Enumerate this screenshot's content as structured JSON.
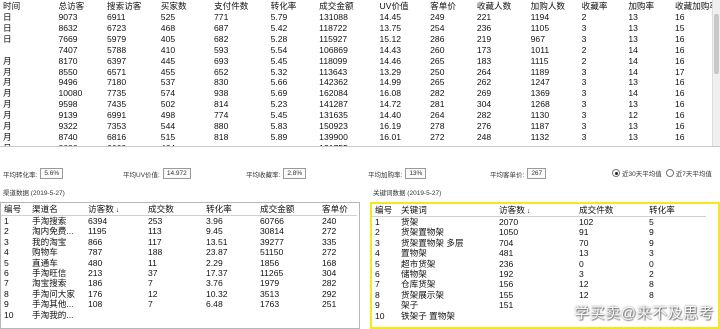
{
  "top_table": {
    "headers": [
      "时间",
      "总访客",
      "搜索访客",
      "买家数",
      "支付件数",
      "转化率",
      "成交金额",
      "UV价值",
      "客单价",
      "收藏人数",
      "加购人数",
      "收藏率",
      "加购率",
      "收藏加购率"
    ],
    "rows": [
      [
        "日",
        "9073",
        "6911",
        "525",
        "771",
        "5.79",
        "131088",
        "14.45",
        "249",
        "221",
        "1194",
        "2",
        "13",
        "16"
      ],
      [
        "日",
        "8632",
        "6723",
        "468",
        "687",
        "5.42",
        "118722",
        "13.75",
        "254",
        "236",
        "1105",
        "3",
        "13",
        "15"
      ],
      [
        "日",
        "7669",
        "5979",
        "405",
        "682",
        "5.28",
        "115927",
        "15.12",
        "286",
        "219",
        "967",
        "3",
        "13",
        "16"
      ],
      [
        "",
        "7407",
        "5788",
        "410",
        "593",
        "5.54",
        "106869",
        "14.43",
        "260",
        "173",
        "1011",
        "2",
        "14",
        "16"
      ],
      [
        "月",
        "8170",
        "6397",
        "445",
        "693",
        "5.45",
        "118099",
        "14.46",
        "265",
        "183",
        "1115",
        "2",
        "14",
        "16"
      ],
      [
        "月",
        "8550",
        "6571",
        "455",
        "652",
        "5.32",
        "113643",
        "13.29",
        "250",
        "264",
        "1189",
        "3",
        "14",
        "17"
      ],
      [
        "月",
        "9496",
        "7180",
        "537",
        "830",
        "5.66",
        "142362",
        "14.99",
        "265",
        "262",
        "1247",
        "3",
        "13",
        "16"
      ],
      [
        "月",
        "10080",
        "7735",
        "574",
        "938",
        "5.69",
        "162084",
        "16.08",
        "282",
        "269",
        "1369",
        "3",
        "14",
        "16"
      ],
      [
        "月",
        "9598",
        "7435",
        "502",
        "814",
        "5.23",
        "141287",
        "14.72",
        "281",
        "304",
        "1268",
        "3",
        "13",
        "16"
      ],
      [
        "月",
        "9139",
        "6991",
        "498",
        "774",
        "5.45",
        "131635",
        "14.40",
        "264",
        "282",
        "1130",
        "3",
        "12",
        "16"
      ],
      [
        "月",
        "9322",
        "7353",
        "544",
        "880",
        "5.83",
        "150923",
        "16.19",
        "278",
        "276",
        "1187",
        "3",
        "13",
        "16"
      ],
      [
        "月",
        "8740",
        "6816",
        "515",
        "818",
        "5.89",
        "139900",
        "16.01",
        "272",
        "248",
        "1132",
        "3",
        "13",
        "16"
      ],
      [
        "月",
        "8686",
        "6660",
        "464",
        "",
        "",
        "131755",
        "",
        "",
        "",
        "",
        "",
        "",
        ""
      ]
    ]
  },
  "summary": {
    "items": [
      {
        "label": "平均转化率:",
        "value": "5.6%"
      },
      {
        "label": "平均UV价值:",
        "value": "14.972"
      },
      {
        "label": "平均收藏率:",
        "value": "2.8%"
      },
      {
        "label": "平均加购率:",
        "value": "13%"
      },
      {
        "label": "平均客单价:",
        "value": "267"
      }
    ],
    "radio_30": "近30天平均值",
    "radio_7": "近7天平均值"
  },
  "channel_panel": {
    "title": "渠道数据 (2019-5-27)",
    "headers": [
      "编号",
      "渠道名",
      "访客数",
      "成交数",
      "转化率",
      "成交金额",
      "客单价"
    ],
    "sort_indicator": "↓",
    "rows": [
      [
        "1",
        "手淘搜索",
        "6394",
        "253",
        "3.96",
        "60766",
        "240"
      ],
      [
        "2",
        "淘内免费...",
        "1195",
        "113",
        "9.45",
        "30814",
        "272"
      ],
      [
        "3",
        "我的淘宝",
        "866",
        "117",
        "13.51",
        "39277",
        "335"
      ],
      [
        "4",
        "购物车",
        "787",
        "188",
        "23.87",
        "51150",
        "272"
      ],
      [
        "5",
        "直通车",
        "480",
        "11",
        "2.29",
        "1856",
        "168"
      ],
      [
        "6",
        "手淘旺信",
        "213",
        "37",
        "17.37",
        "11265",
        "304"
      ],
      [
        "7",
        "淘宝搜索",
        "186",
        "7",
        "3.76",
        "1979",
        "282"
      ],
      [
        "8",
        "手淘问大家",
        "176",
        "12",
        "10.32",
        "3513",
        "292"
      ],
      [
        "9",
        "手淘其他...",
        "108",
        "7",
        "6.48",
        "1763",
        "251"
      ],
      [
        "10",
        "手淘我的...",
        "",
        "",
        "",
        "",
        ""
      ]
    ]
  },
  "keyword_panel": {
    "title": "关键词数据 (2019-5-27)",
    "headers": [
      "编号",
      "关键词",
      "访客数",
      "成交件数",
      "转化率"
    ],
    "sort_indicator": "↓",
    "rows": [
      [
        "1",
        "货架",
        "2070",
        "102",
        "5"
      ],
      [
        "2",
        "货架置物架",
        "1050",
        "91",
        "9"
      ],
      [
        "3",
        "货架置物架 多层",
        "704",
        "70",
        "9"
      ],
      [
        "4",
        "置物架",
        "481",
        "13",
        "3"
      ],
      [
        "5",
        "超市货架",
        "236",
        "0",
        "0"
      ],
      [
        "6",
        "储物架",
        "192",
        "3",
        "2"
      ],
      [
        "7",
        "仓库货架",
        "156",
        "12",
        "8"
      ],
      [
        "8",
        "货架展示架",
        "155",
        "12",
        "8"
      ],
      [
        "9",
        "架子",
        "151",
        "",
        ""
      ],
      [
        "10",
        "铁架子 置物架",
        "",
        "",
        ""
      ]
    ]
  },
  "watermark": "学买卖@来不及思考"
}
